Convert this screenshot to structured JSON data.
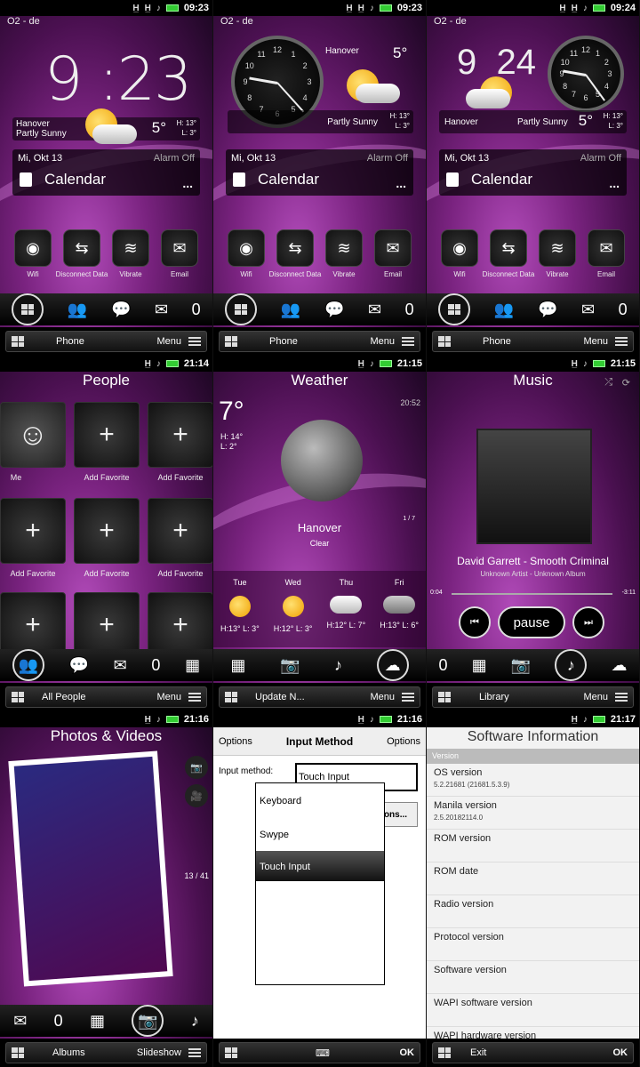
{
  "status": {
    "times": [
      "09:23",
      "09:23",
      "09:24",
      "21:14",
      "21:15",
      "21:15",
      "21:16",
      "21:16",
      "21:17"
    ],
    "carrier": "O2 - de"
  },
  "home": {
    "time_h": "9",
    "time_m": ":23",
    "time_h3": "9",
    "time_m3": "24",
    "city": "Hanover",
    "cond": "Partly Sunny",
    "temp": "5°",
    "hi": "H:  13°",
    "lo": "L:    3°",
    "date": "Mi, Okt 13",
    "alarm": "Alarm Off",
    "calendar": "Calendar",
    "dots": "...",
    "quick": [
      "Wifi",
      "Disconnect Data",
      "Vibrate",
      "Email"
    ],
    "soft_left": "Phone",
    "soft_right": "Menu",
    "clock_numbers": [
      "12",
      "1",
      "2",
      "3",
      "4",
      "5",
      "6",
      "7",
      "8",
      "9",
      "10",
      "11"
    ]
  },
  "people": {
    "title": "People",
    "me": "Me",
    "add": "Add Favorite",
    "soft_left": "All People",
    "soft_right": "Menu"
  },
  "weather": {
    "title": "Weather",
    "temp": "7°",
    "hi": "H: 14°",
    "lo": "L:   2°",
    "time": "20:52",
    "city": "Hanover",
    "cond": "Clear",
    "page": "1 / 7",
    "days": [
      {
        "d": "Tue",
        "t": "H:13° L: 3°"
      },
      {
        "d": "Wed",
        "t": "H:12° L: 3°"
      },
      {
        "d": "Thu",
        "t": "H:12° L: 7°"
      },
      {
        "d": "Fri",
        "t": "H:13° L: 6°"
      }
    ],
    "soft_left": "Update N...",
    "soft_right": "Menu"
  },
  "music": {
    "title": "Music",
    "track": "David Garrett - Smooth Criminal",
    "sub": "Unknown Artist - Unknown Album",
    "elapsed": "0:04",
    "remain": "-3:11",
    "pause": "pause",
    "soft_left": "Library",
    "soft_right": "Menu"
  },
  "photos": {
    "title": "Photos & Videos",
    "count": "13 / 41",
    "soft_left": "Albums",
    "soft_right": "Slideshow"
  },
  "input": {
    "left": "Options",
    "title": "Input Method",
    "right": "Options",
    "label": "Input method:",
    "value": "Touch Input",
    "options_btn": "ons...",
    "items": [
      "Keyboard",
      "Swype",
      "Touch Input"
    ],
    "ok": "OK"
  },
  "software": {
    "title": "Software Information",
    "section": "Version",
    "rows": [
      {
        "k": "OS version",
        "v": "5.2.21681 (21681.5.3.9)"
      },
      {
        "k": "Manila version",
        "v": "2.5.20182114.0"
      },
      {
        "k": "ROM version",
        "v": ""
      },
      {
        "k": "ROM date",
        "v": ""
      },
      {
        "k": "Radio version",
        "v": ""
      },
      {
        "k": "Protocol version",
        "v": ""
      },
      {
        "k": "Software version",
        "v": ""
      },
      {
        "k": "WAPI software version",
        "v": ""
      },
      {
        "k": "WAPI hardware version",
        "v": ""
      }
    ],
    "exit": "Exit",
    "ok": "OK"
  }
}
